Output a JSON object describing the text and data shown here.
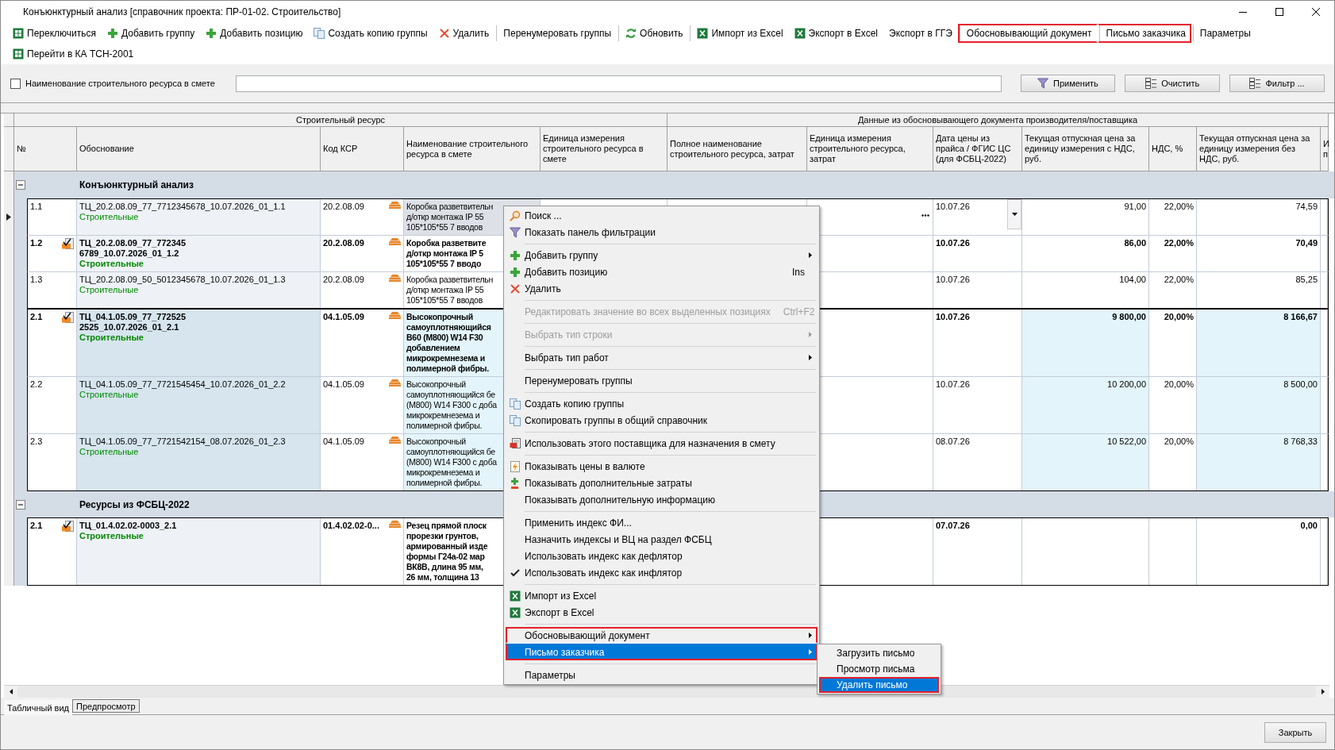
{
  "window": {
    "title": "Конъюнктурный анализ [справочник проекта: ПР-01-02. Строительство]"
  },
  "toolbar": {
    "rows": [
      [
        {
          "label": "Переключиться",
          "kind": "table",
          "separator_before": false,
          "highlighted": false
        },
        {
          "label": "Добавить группу",
          "kind": "plus",
          "separator_before": false,
          "highlighted": false
        },
        {
          "label": "Добавить позицию",
          "kind": "plus",
          "separator_before": false,
          "highlighted": false
        },
        {
          "label": "Создать копию группы",
          "kind": "copy",
          "separator_before": false,
          "highlighted": false
        },
        {
          "label": "Удалить",
          "kind": "delete",
          "separator_before": false,
          "highlighted": false
        },
        {
          "label": "Перенумеровать группы",
          "kind": "plain",
          "separator_before": true,
          "highlighted": false
        },
        {
          "label": "Обновить",
          "kind": "refresh",
          "separator_before": true,
          "highlighted": false
        },
        {
          "label": "Импорт из Excel",
          "kind": "excel",
          "separator_before": true,
          "highlighted": false
        },
        {
          "label": "Экспорт в Excel",
          "kind": "excel",
          "separator_before": false,
          "highlighted": false
        },
        {
          "label": "Экспорт в ГГЭ",
          "kind": "plain",
          "separator_before": false,
          "highlighted": false
        },
        {
          "label": "Обосновывающий документ",
          "kind": "plain",
          "separator_before": true,
          "highlighted": true
        },
        {
          "label": "Письмо заказчика",
          "kind": "plain",
          "separator_before": true,
          "highlighted": true
        },
        {
          "label": "Параметры",
          "kind": "plain",
          "separator_before": true,
          "highlighted": false
        }
      ],
      [
        {
          "label": "Перейти в КА ТСН-2001",
          "kind": "table",
          "separator_before": false,
          "highlighted": false
        }
      ]
    ]
  },
  "filter": {
    "checkbox": {
      "label": "Наименование строительного ресурса в смете",
      "checked": false
    },
    "buttons": [
      {
        "label": "Применить",
        "kind": "filter"
      },
      {
        "label": "Очистить",
        "kind": "clear"
      },
      {
        "label": "Фильтр ...",
        "kind": "clear"
      }
    ]
  },
  "table": {
    "header_groups": [
      {
        "label": "Строительный ресурс",
        "columns": [
          "№",
          "Обоснование",
          "Код КСР",
          "Наименование строительного ресурса в смете",
          "Единица измерения строительного ресурса в смете"
        ]
      },
      {
        "label": "Данные из обосновывающего документа производителя/поставщика",
        "columns": [
          "Полное наименование строительного ресурса, затрат",
          "Единица измерения строительного ресурса, затрат",
          "Дата цены из прайса / ФГИС ЦС (для ФСБЦ-2022)",
          "Текущая отпускная цена за единицу измерения с НДС, руб.",
          "НДС, %",
          "Текущая отпускная цена за единицу измерения без НДС, руб.",
          "И п"
        ]
      }
    ],
    "groups": [
      {
        "title": "Конъюнктурный анализ",
        "expanded": true,
        "subgroups": [
          {
            "selected": false,
            "rows": [
              {
                "num": "1.1",
                "bold": false,
                "marked": false,
                "focused": true,
                "basis_lines": [
                  "ТЦ_20.2.08.09_77_7712345678_10.07.2026_01_1.1"
                ],
                "category": "Строительные",
                "code": "20.2.08.09",
                "name_lines": [
                  "Коробка разветвительн",
                  "д/откр монтажа IP 55",
                  "105*105*55 7 вводов"
                ],
                "date": "10.07.26",
                "price_vat": "91,00",
                "vat": "22,00%",
                "price": "74,59"
              },
              {
                "num": "1.2",
                "bold": true,
                "marked": true,
                "focused": false,
                "basis_lines": [
                  "ТЦ_20.2.08.09_77_772345",
                  "6789_10.07.2026_01_1.2"
                ],
                "category": "Строительные",
                "code": "20.2.08.09",
                "name_lines": [
                  "Коробка разветвите",
                  "д/откр монтажа IP 5",
                  "105*105*55 7 вводо"
                ],
                "date": "10.07.26",
                "price_vat": "86,00",
                "vat": "22,00%",
                "price": "70,49"
              },
              {
                "num": "1.3",
                "bold": false,
                "marked": false,
                "focused": false,
                "basis_lines": [
                  "ТЦ_20.2.08.09_50_5012345678_10.07.2026_01_1.3"
                ],
                "category": "Строительные",
                "code": "20.2.08.09",
                "name_lines": [
                  "Коробка разветвительн",
                  "д/откр монтажа IP 55",
                  "105*105*55 7 вводов"
                ],
                "date": "10.07.26",
                "price_vat": "104,00",
                "vat": "22,00%",
                "price": "85,25"
              }
            ]
          },
          {
            "selected": true,
            "rows": [
              {
                "num": "2.1",
                "bold": true,
                "marked": true,
                "focused": false,
                "basis_lines": [
                  "ТЦ_04.1.05.09_77_772525",
                  "2525_10.07.2026_01_2.1"
                ],
                "category": "Строительные",
                "code": "04.1.05.09",
                "name_lines": [
                  "Высокопрочный",
                  "самоуплотняющийся",
                  "В60 (М800) W14 F30",
                  "добавлением",
                  "микрокремнезема и",
                  "полимерной фибры."
                ],
                "date": "10.07.26",
                "price_vat": "9 800,00",
                "vat": "20,00%",
                "price": "8 166,67"
              },
              {
                "num": "2.2",
                "bold": false,
                "marked": false,
                "focused": false,
                "basis_lines": [
                  "ТЦ_04.1.05.09_77_7721545454_10.07.2026_01_2.2"
                ],
                "category": "Строительные",
                "code": "04.1.05.09",
                "name_lines": [
                  "Высокопрочный",
                  "самоуплотняющийся бе",
                  "(М800) W14 F300 с доба",
                  "микрокремнезема и",
                  "полимерной фибры."
                ],
                "date": "10.07.26",
                "price_vat": "10 200,00",
                "vat": "20,00%",
                "price": "8 500,00"
              },
              {
                "num": "2.3",
                "bold": false,
                "marked": false,
                "focused": false,
                "basis_lines": [
                  "ТЦ_04.1.05.09_77_7721542154_08.07.2026_01_2.3"
                ],
                "category": "Строительные",
                "code": "04.1.05.09",
                "name_lines": [
                  "Высокопрочный",
                  "самоуплотняющийся бе",
                  "(М800) W14 F300 с доба",
                  "микрокремнезема и",
                  "полимерной фибры."
                ],
                "date": "08.07.26",
                "price_vat": "10 522,00",
                "vat": "20,00%",
                "price": "8 768,33"
              }
            ]
          }
        ]
      },
      {
        "title": "Ресурсы из ФСБЦ-2022",
        "expanded": true,
        "subgroups": [
          {
            "selected": false,
            "rows": [
              {
                "num": "2.1",
                "bold": true,
                "marked": true,
                "focused": false,
                "basis_lines": [
                  "ТЦ_01.4.02.02-0003_2.1"
                ],
                "category": "Строительные",
                "code": "01.4.02.02-0...",
                "name_lines": [
                  "Резец прямой плоск",
                  "прорезки грунтов,",
                  "армированный изде",
                  "формы Г24а-02 мар",
                  "ВК8В, длина 95 мм,",
                  "26 мм, толщина 13"
                ],
                "date": "07.07.26",
                "price": "0,00"
              }
            ]
          }
        ]
      }
    ]
  },
  "context_menu": {
    "sections": [
      [
        {
          "label": "Поиск ...",
          "kind": "search",
          "submenu": false,
          "disabled": false,
          "checked": false,
          "selected": false,
          "highlighted": false
        },
        {
          "label": "Показать панель фильтрации",
          "kind": "filter",
          "submenu": false,
          "disabled": false,
          "checked": false,
          "selected": false,
          "highlighted": false
        }
      ],
      [
        {
          "label": "Добавить группу",
          "kind": "plus",
          "submenu": true,
          "disabled": false,
          "checked": false,
          "selected": false,
          "highlighted": false
        },
        {
          "label": "Добавить позицию",
          "kind": "plus",
          "shortcut": "Ins",
          "submenu": false,
          "disabled": false,
          "checked": false,
          "selected": false,
          "highlighted": false
        },
        {
          "label": "Удалить",
          "kind": "delete",
          "submenu": false,
          "disabled": false,
          "checked": false,
          "selected": false,
          "highlighted": false
        }
      ],
      [
        {
          "label": "Редактировать значение во всех выделенных позициях",
          "kind": "plain",
          "shortcut": "Ctrl+F2",
          "submenu": false,
          "disabled": true,
          "checked": false,
          "selected": false,
          "highlighted": false
        }
      ],
      [
        {
          "label": "Выбрать тип строки",
          "kind": "plain",
          "submenu": true,
          "disabled": true,
          "checked": false,
          "selected": false,
          "highlighted": false
        }
      ],
      [
        {
          "label": "Выбрать тип работ",
          "kind": "plain",
          "submenu": true,
          "disabled": false,
          "checked": false,
          "selected": false,
          "highlighted": false
        }
      ],
      [
        {
          "label": "Перенумеровать группы",
          "kind": "plain",
          "submenu": false,
          "disabled": false,
          "checked": false,
          "selected": false,
          "highlighted": false
        }
      ],
      [
        {
          "label": "Создать копию группы",
          "kind": "copy",
          "submenu": false,
          "disabled": false,
          "checked": false,
          "selected": false,
          "highlighted": false
        },
        {
          "label": "Скопировать группы в общий справочник",
          "kind": "copy",
          "submenu": false,
          "disabled": false,
          "checked": false,
          "selected": false,
          "highlighted": false
        }
      ],
      [
        {
          "label": "Использовать этого поставщика для назначения в смету",
          "kind": "supplier",
          "submenu": false,
          "disabled": false,
          "checked": false,
          "selected": false,
          "highlighted": false
        }
      ],
      [
        {
          "label": "Показывать цены в валюте",
          "kind": "currency",
          "submenu": false,
          "disabled": false,
          "checked": false,
          "selected": false,
          "highlighted": false
        },
        {
          "label": "Показывать дополнительные затраты",
          "kind": "extra",
          "submenu": false,
          "disabled": false,
          "checked": false,
          "selected": false,
          "highlighted": false
        },
        {
          "label": "Показывать дополнительную информацию",
          "kind": "plain",
          "submenu": false,
          "disabled": false,
          "checked": false,
          "selected": false,
          "highlighted": false
        }
      ],
      [
        {
          "label": "Применить индекс ФИ...",
          "kind": "plain",
          "submenu": false,
          "disabled": false,
          "checked": false,
          "selected": false,
          "highlighted": false
        },
        {
          "label": "Назначить индексы и ВЦ на раздел ФСБЦ",
          "kind": "plain",
          "submenu": false,
          "disabled": false,
          "checked": false,
          "selected": false,
          "highlighted": false
        },
        {
          "label": "Использовать индекс как дефлятор",
          "kind": "plain",
          "submenu": false,
          "disabled": false,
          "checked": false,
          "selected": false,
          "highlighted": false
        },
        {
          "label": "Использовать индекс как инфлятор",
          "kind": "plain",
          "submenu": false,
          "disabled": false,
          "checked": true,
          "selected": false,
          "highlighted": false
        }
      ],
      [
        {
          "label": "Импорт из Excel",
          "kind": "excel",
          "submenu": false,
          "disabled": false,
          "checked": false,
          "selected": false,
          "highlighted": false
        },
        {
          "label": "Экспорт в Excel",
          "kind": "excel",
          "submenu": false,
          "disabled": false,
          "checked": false,
          "selected": false,
          "highlighted": false
        }
      ],
      [
        {
          "label": "Обосновывающий документ",
          "kind": "plain",
          "submenu": true,
          "disabled": false,
          "checked": false,
          "selected": false,
          "highlighted": true
        },
        {
          "label": "Письмо заказчика",
          "kind": "plain",
          "submenu": true,
          "disabled": false,
          "checked": false,
          "selected": true,
          "highlighted": true
        }
      ],
      [
        {
          "label": "Параметры",
          "kind": "plain",
          "submenu": false,
          "disabled": false,
          "checked": false,
          "selected": false,
          "highlighted": false
        }
      ]
    ]
  },
  "submenu": {
    "items": [
      {
        "label": "Загрузить письмо",
        "selected": false,
        "highlighted": false
      },
      {
        "label": "Просмотр письма",
        "selected": false,
        "highlighted": false
      },
      {
        "label": "Удалить письмо",
        "selected": true,
        "highlighted": true
      }
    ]
  },
  "tabs": [
    {
      "label": "Табличный вид",
      "selected": true
    },
    {
      "label": "Предпросмотр",
      "selected": false
    }
  ],
  "footer": {
    "button": "Закрыть"
  }
}
